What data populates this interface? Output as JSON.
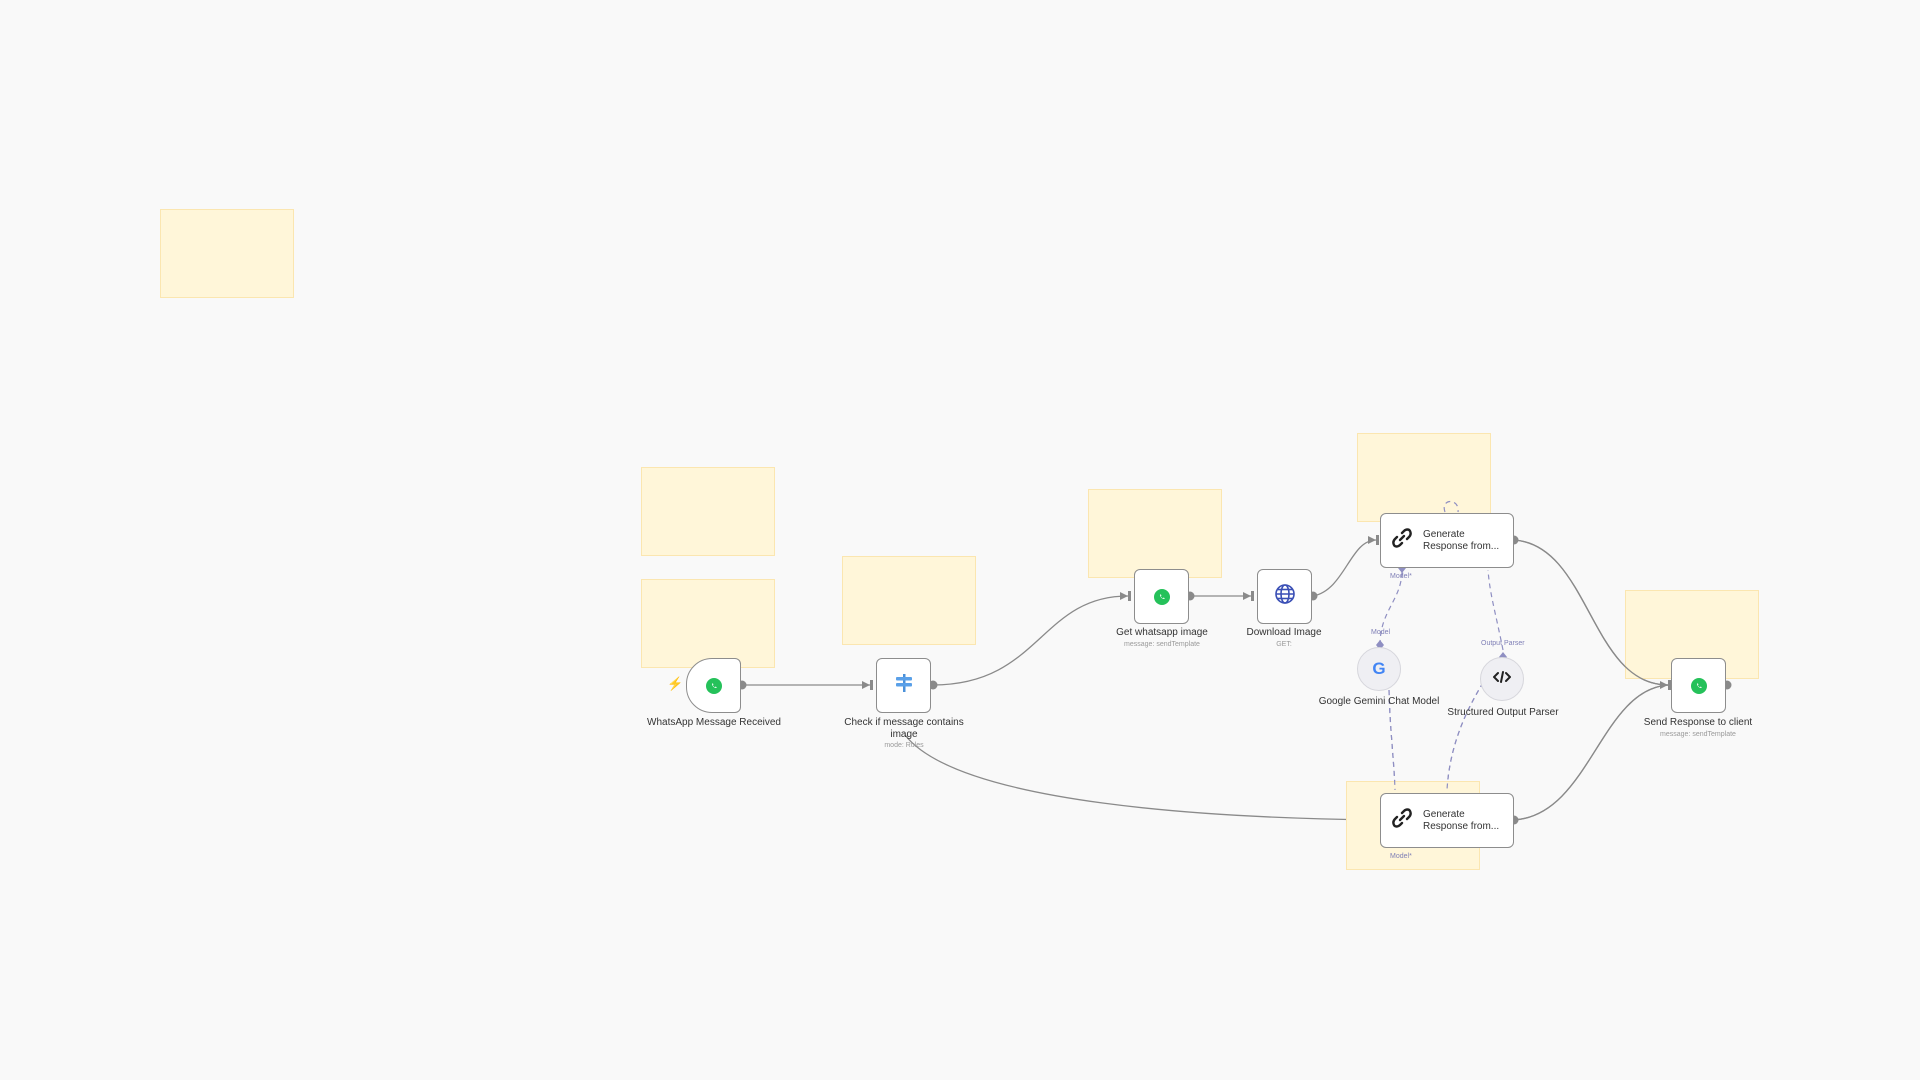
{
  "colors": {
    "background": "#f9f9f9",
    "sticky": "#fff6d9",
    "edge": "#8a8a8a",
    "ai_edge": "#8f8fc2"
  },
  "nodes": {
    "trigger": {
      "label": "WhatsApp Message Received",
      "icon": "whatsapp-icon"
    },
    "switch": {
      "label": "Check if message contains image",
      "sub": "mode: Rules",
      "icon": "signpost-icon"
    },
    "get_image": {
      "label": "Get whatsapp image",
      "sub": "message: sendTemplate",
      "icon": "whatsapp-icon"
    },
    "download": {
      "label": "Download Image",
      "sub": "GET:",
      "icon": "globe-icon"
    },
    "gen_top": {
      "label_line1": "Generate",
      "label_line2": "Response from...",
      "handle": "Model*",
      "icon": "chain-link-icon"
    },
    "gen_bottom": {
      "label_line1": "Generate",
      "label_line2": "Response from...",
      "handle": "Model*",
      "icon": "chain-link-icon"
    },
    "gemini": {
      "label": "Google Gemini Chat Model",
      "handle": "Model",
      "icon": "google-icon"
    },
    "parser": {
      "label": "Structured Output Parser",
      "handle": "Output Parser",
      "icon": "code-icon"
    },
    "send": {
      "label": "Send Response to client",
      "sub": "message: sendTemplate",
      "icon": "whatsapp-icon"
    }
  }
}
